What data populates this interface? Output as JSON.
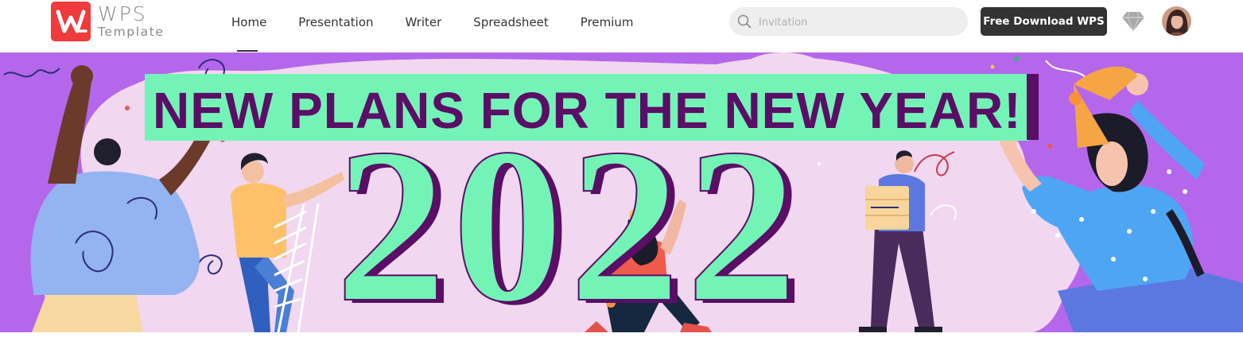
{
  "header": {
    "logo": {
      "brand": "WPS",
      "product": "Template"
    },
    "nav": [
      {
        "label": "Home",
        "active": true
      },
      {
        "label": "Presentation",
        "active": false
      },
      {
        "label": "Writer",
        "active": false
      },
      {
        "label": "Spreadsheet",
        "active": false
      },
      {
        "label": "Premium",
        "active": false
      }
    ],
    "search": {
      "placeholder": "Invitation",
      "value": "",
      "icon": "search-icon"
    },
    "download_button": "Free Download WPS",
    "premium_icon": "diamond-icon",
    "avatar": "user-avatar"
  },
  "banner": {
    "headline": "NEW PLANS FOR THE NEW YEAR!",
    "year": [
      "2",
      "0",
      "2",
      "2"
    ],
    "colors": {
      "background": "#b467eb",
      "mint": "#73f4b6",
      "purple": "#5a0e66",
      "blob": "#f1d7ef"
    }
  },
  "colors": {
    "brand_red": "#ef3b3b",
    "dark_button": "#333333"
  }
}
